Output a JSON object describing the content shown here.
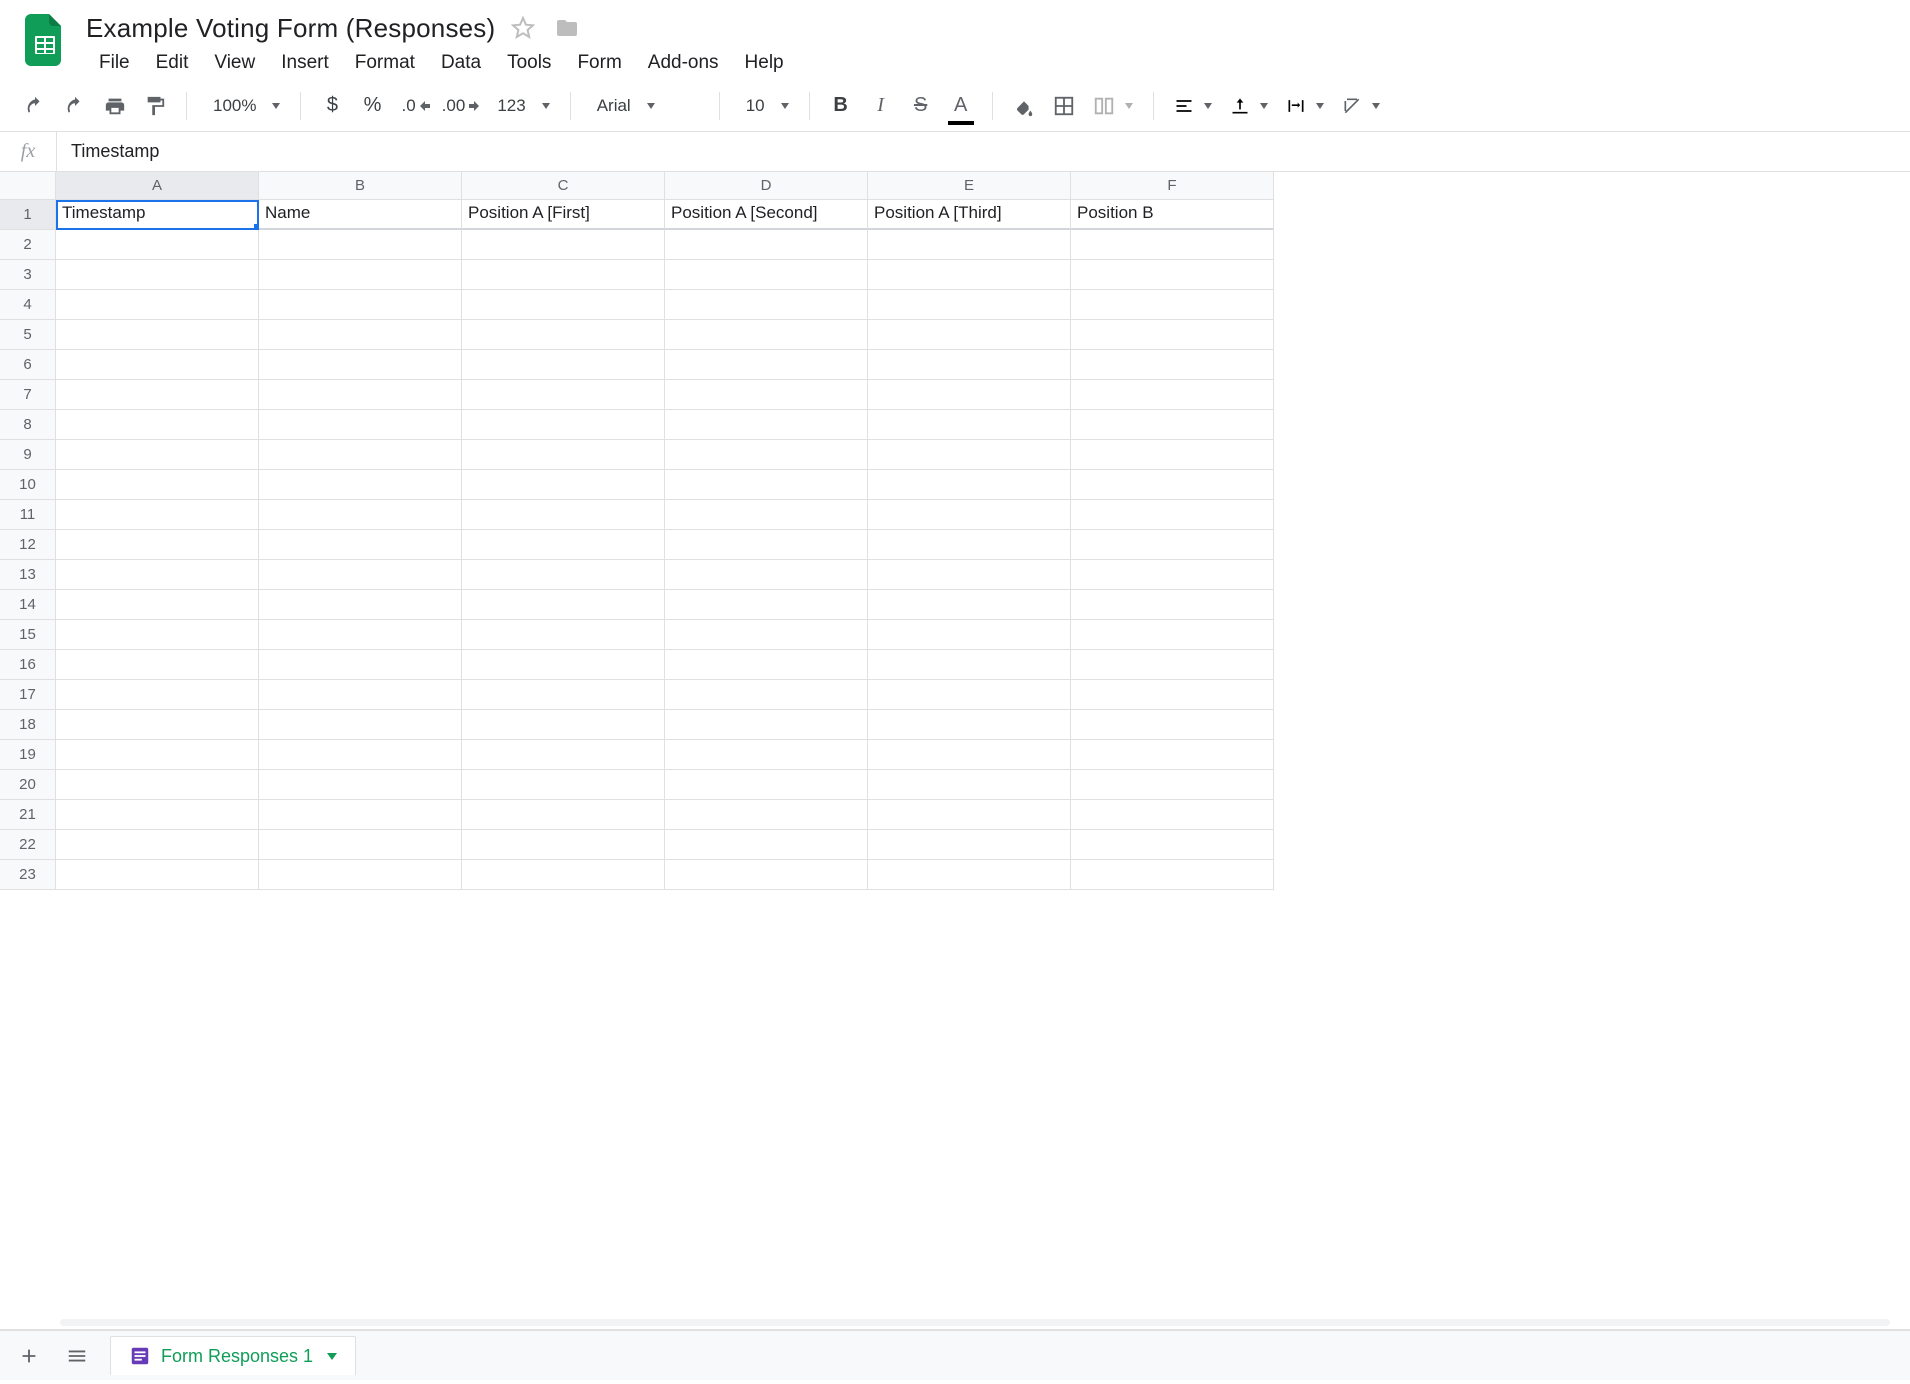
{
  "header": {
    "title": "Example Voting Form (Responses)"
  },
  "menubar": [
    "File",
    "Edit",
    "View",
    "Insert",
    "Format",
    "Data",
    "Tools",
    "Form",
    "Add-ons",
    "Help"
  ],
  "toolbar": {
    "zoom": "100%",
    "fmt123": "123",
    "font": "Arial",
    "fontsize": "10",
    "dec_decrease": ".0",
    "dec_increase": ".00"
  },
  "formula_bar": {
    "fx_label": "fx",
    "value": "Timestamp"
  },
  "grid": {
    "columns": [
      "A",
      "B",
      "C",
      "D",
      "E",
      "F"
    ],
    "row_count": 23,
    "selected": {
      "row": 1,
      "col": "A"
    },
    "rows": [
      [
        "Timestamp",
        "Name",
        "Position A [First]",
        "Position A [Second]",
        "Position A [Third]",
        "Position B"
      ]
    ]
  },
  "sheet_tabs": {
    "active": "Form Responses 1"
  }
}
